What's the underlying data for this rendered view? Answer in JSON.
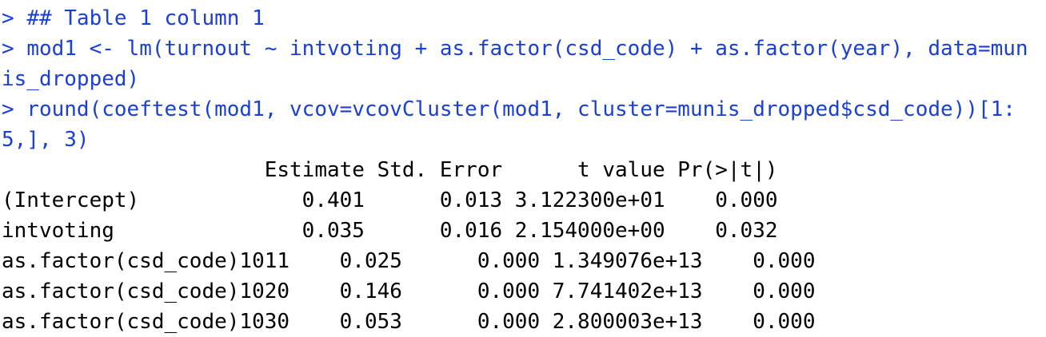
{
  "console": {
    "prompt": ">",
    "commands": [
      {
        "prompt": "> ",
        "text": "## Table 1 column 1"
      },
      {
        "prompt": "> ",
        "text": "mod1 <- lm(turnout ~ intvoting + as.factor(csd_code) + as.factor(year), data=mun"
      },
      {
        "prompt": "",
        "text": "is_dropped)"
      },
      {
        "prompt": "> ",
        "text": "round(coeftest(mod1, vcov=vcovCluster(mod1, cluster=munis_dropped$csd_code))[1:"
      },
      {
        "prompt": "",
        "text": "5,], 3)"
      }
    ],
    "output": {
      "header": "                     Estimate Std. Error      t value Pr(>|t|)",
      "rows": [
        "(Intercept)             0.401      0.013 3.122300e+01    0.000",
        "intvoting               0.035      0.016 2.154000e+00    0.032",
        "as.factor(csd_code)1011    0.025      0.000 1.349076e+13    0.000",
        "as.factor(csd_code)1020    0.146      0.000 7.741402e+13    0.000",
        "as.factor(csd_code)1030    0.053      0.000 2.800003e+13    0.000"
      ]
    }
  }
}
